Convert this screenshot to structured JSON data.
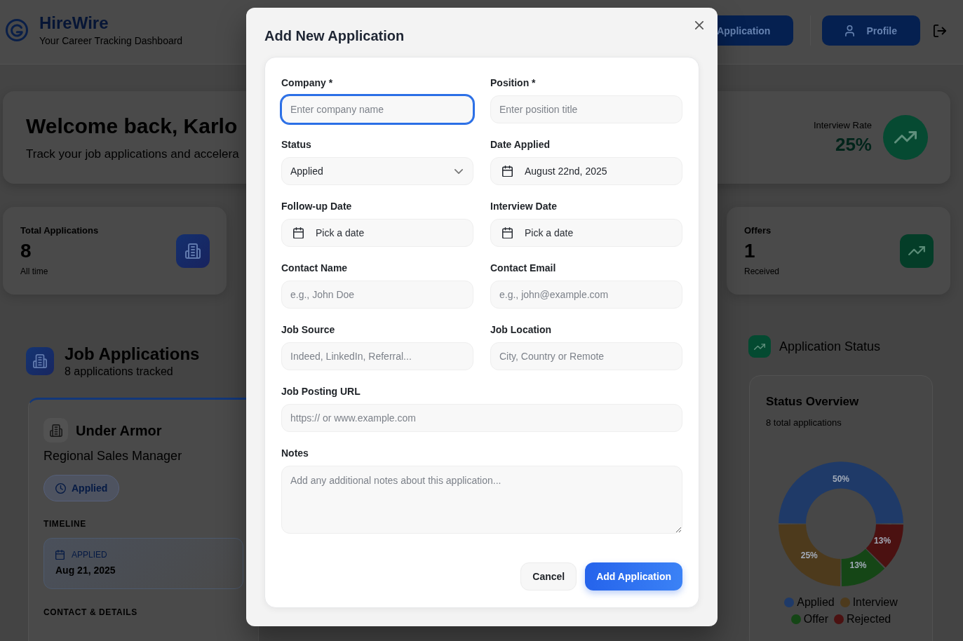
{
  "header": {
    "app_name": "HireWire",
    "tagline": "Your Career Tracking Dashboard",
    "actions": [
      {
        "kind": "add",
        "label": "Application"
      },
      {
        "kind": "profile",
        "label": "Profile"
      },
      {
        "kind": "logout"
      }
    ]
  },
  "welcome": {
    "title": "Welcome back, Karlo",
    "subtitle": "Track your job applications and accelera",
    "rate_label": "Interview Rate",
    "rate_value": "25%"
  },
  "stats": [
    {
      "kind": "total",
      "label": "Total Applications",
      "value": "8",
      "note": "All time"
    },
    {
      "kind": "offers",
      "label": "Offers",
      "value": "1",
      "note": "Received"
    }
  ],
  "applications": {
    "title": "Job Applications",
    "subtitle": "8 applications tracked",
    "cards": [
      {
        "company": "Under Armor",
        "position": "Regional Sales Manager",
        "status": {
          "kind": "applied",
          "label": "Applied"
        },
        "timeline_heading": "TIMELINE",
        "timeline": [
          {
            "label": "APPLIED",
            "date": "Aug 21, 2025"
          }
        ],
        "details_heading": "CONTACT & DETAILS"
      }
    ]
  },
  "status_panel": {
    "title": "Application Status",
    "overview": {
      "title": "Status Overview",
      "subtitle": "8 total applications",
      "chart_data": {
        "type": "donut",
        "categories": [
          "Applied",
          "Interview",
          "Offer",
          "Rejected"
        ],
        "values": [
          50,
          25,
          12.5,
          12.5
        ],
        "value_labels": [
          "50%",
          "25%",
          "13%",
          "13%"
        ]
      },
      "legend": [
        {
          "color": "#1f3a68"
        },
        {
          "color": "#4d3a1c"
        },
        {
          "color": "#154616"
        },
        {
          "color": "#4b1111"
        }
      ]
    }
  },
  "modal": {
    "title": "Add New Application",
    "fields": [
      {
        "kind": "text",
        "label": "Company *",
        "placeholder": "Enter company name",
        "focused": true
      },
      {
        "kind": "text",
        "label": "Position *",
        "placeholder": "Enter position title",
        "focused": false
      },
      {
        "kind": "select",
        "label": "Status",
        "value": "Applied",
        "focused": false
      },
      {
        "kind": "date",
        "label": "Date Applied",
        "value": "August 22nd, 2025",
        "focused": false
      },
      {
        "kind": "date",
        "label": "Follow-up Date",
        "placeholder": "Pick a date",
        "focused": false
      },
      {
        "kind": "date",
        "label": "Interview Date",
        "placeholder": "Pick a date",
        "focused": false
      },
      {
        "kind": "text",
        "label": "Contact Name",
        "placeholder": "e.g., John Doe",
        "focused": false
      },
      {
        "kind": "text",
        "label": "Contact Email",
        "placeholder": "e.g., john@example.com",
        "focused": false
      },
      {
        "kind": "text",
        "label": "Job Source",
        "placeholder": "Indeed, LinkedIn, Referral...",
        "focused": false
      },
      {
        "kind": "text",
        "label": "Job Location",
        "placeholder": "City, Country or Remote",
        "focused": false
      },
      {
        "kind": "url",
        "label": "Job Posting URL",
        "placeholder": "https:// or www.example.com",
        "focused": false
      },
      {
        "kind": "textarea",
        "label": "Notes",
        "placeholder": "Add any additional notes about this application...",
        "focused": false
      }
    ],
    "buttons": [
      {
        "kind": "secondary",
        "label": "Cancel"
      },
      {
        "kind": "primary",
        "label": "Add Application"
      }
    ]
  }
}
